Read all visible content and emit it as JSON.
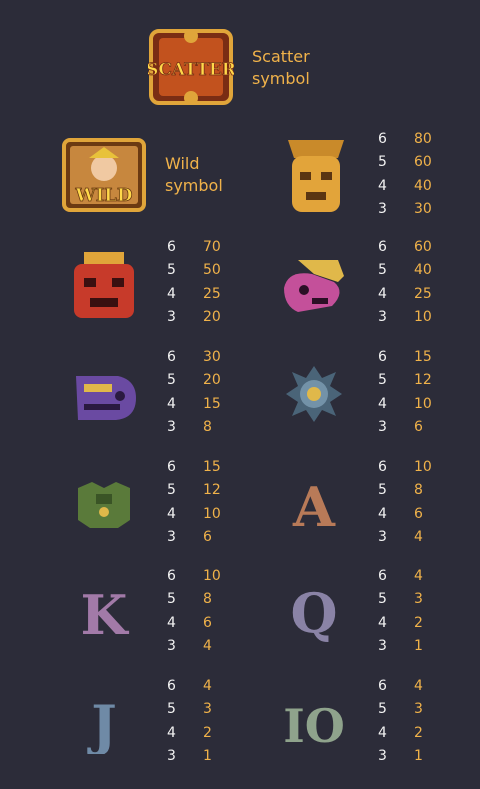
{
  "special": {
    "scatter": {
      "tile_text": "SCATTER",
      "label_line1": "Scatter",
      "label_line2": "symbol"
    },
    "wild": {
      "tile_text": "WILD",
      "label_line1": "Wild",
      "label_line2": "symbol"
    }
  },
  "paytable": [
    {
      "icon": "gold-mask-icon",
      "rows": [
        {
          "count": "6",
          "payout": "80"
        },
        {
          "count": "5",
          "payout": "60"
        },
        {
          "count": "4",
          "payout": "40"
        },
        {
          "count": "3",
          "payout": "30"
        }
      ]
    },
    {
      "icon": "red-mask-icon",
      "rows": [
        {
          "count": "6",
          "payout": "70"
        },
        {
          "count": "5",
          "payout": "50"
        },
        {
          "count": "4",
          "payout": "25"
        },
        {
          "count": "3",
          "payout": "20"
        }
      ]
    },
    {
      "icon": "pink-serpent-icon",
      "rows": [
        {
          "count": "6",
          "payout": "60"
        },
        {
          "count": "5",
          "payout": "40"
        },
        {
          "count": "4",
          "payout": "25"
        },
        {
          "count": "3",
          "payout": "10"
        }
      ]
    },
    {
      "icon": "purple-serpent-icon",
      "rows": [
        {
          "count": "6",
          "payout": "30"
        },
        {
          "count": "5",
          "payout": "20"
        },
        {
          "count": "4",
          "payout": "15"
        },
        {
          "count": "3",
          "payout": "8"
        }
      ]
    },
    {
      "icon": "blue-glyph-icon",
      "rows": [
        {
          "count": "6",
          "payout": "15"
        },
        {
          "count": "5",
          "payout": "12"
        },
        {
          "count": "4",
          "payout": "10"
        },
        {
          "count": "3",
          "payout": "6"
        }
      ]
    },
    {
      "icon": "green-glyph-icon",
      "rows": [
        {
          "count": "6",
          "payout": "15"
        },
        {
          "count": "5",
          "payout": "12"
        },
        {
          "count": "4",
          "payout": "10"
        },
        {
          "count": "3",
          "payout": "6"
        }
      ]
    },
    {
      "icon": "letter-a-icon",
      "glyph": "A",
      "color": "#b87a58",
      "rows": [
        {
          "count": "6",
          "payout": "10"
        },
        {
          "count": "5",
          "payout": "8"
        },
        {
          "count": "4",
          "payout": "6"
        },
        {
          "count": "3",
          "payout": "4"
        }
      ]
    },
    {
      "icon": "letter-k-icon",
      "glyph": "K",
      "color": "#a27aa8",
      "rows": [
        {
          "count": "6",
          "payout": "10"
        },
        {
          "count": "5",
          "payout": "8"
        },
        {
          "count": "4",
          "payout": "6"
        },
        {
          "count": "3",
          "payout": "4"
        }
      ]
    },
    {
      "icon": "letter-q-icon",
      "glyph": "Q",
      "color": "#8a83a6",
      "rows": [
        {
          "count": "6",
          "payout": "4"
        },
        {
          "count": "5",
          "payout": "3"
        },
        {
          "count": "4",
          "payout": "2"
        },
        {
          "count": "3",
          "payout": "1"
        }
      ]
    },
    {
      "icon": "letter-j-icon",
      "glyph": "J",
      "color": "#6f8aa6",
      "rows": [
        {
          "count": "6",
          "payout": "4"
        },
        {
          "count": "5",
          "payout": "3"
        },
        {
          "count": "4",
          "payout": "2"
        },
        {
          "count": "3",
          "payout": "1"
        }
      ]
    },
    {
      "icon": "number-10-icon",
      "glyph": "IO",
      "color": "#8fa38c",
      "rows": [
        {
          "count": "6",
          "payout": "4"
        },
        {
          "count": "5",
          "payout": "3"
        },
        {
          "count": "4",
          "payout": "2"
        },
        {
          "count": "3",
          "payout": "1"
        }
      ]
    }
  ]
}
